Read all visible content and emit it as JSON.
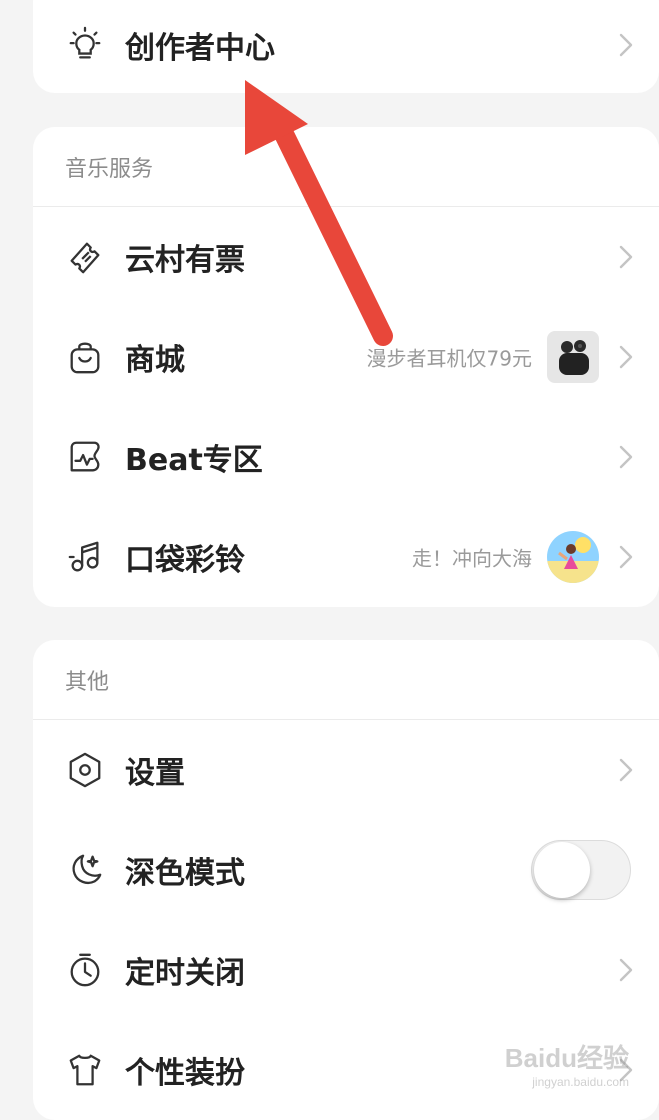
{
  "top_card": {
    "label": "创作者中心",
    "icon": "lightbulb-icon"
  },
  "music": {
    "title": "音乐服务",
    "items": [
      {
        "label": "云村有票",
        "icon": "ticket-icon"
      },
      {
        "label": "商城",
        "icon": "shopping-bag-icon",
        "sub": "漫步者耳机仅79元",
        "thumb": "earbuds-thumbnail"
      },
      {
        "label": "Beat专区",
        "icon": "beat-pulse-icon"
      },
      {
        "label": "口袋彩铃",
        "icon": "music-note-icon",
        "sub": "走！冲向大海",
        "thumb": "beach-avatar"
      }
    ]
  },
  "other": {
    "title": "其他",
    "items": [
      {
        "label": "设置",
        "icon": "settings-hexagon-icon"
      },
      {
        "label": "深色模式",
        "icon": "moon-icon",
        "toggle": false
      },
      {
        "label": "定时关闭",
        "icon": "timer-icon"
      },
      {
        "label": "个性装扮",
        "icon": "tshirt-icon"
      }
    ]
  },
  "watermark": {
    "main": "Baidu经验",
    "sub": "jingyan.baidu.com"
  },
  "colors": {
    "arrow": "#e8473a",
    "card_bg": "#ffffff",
    "page_bg": "#f4f4f4",
    "text": "#222222",
    "subtext": "#9a9a9a"
  }
}
